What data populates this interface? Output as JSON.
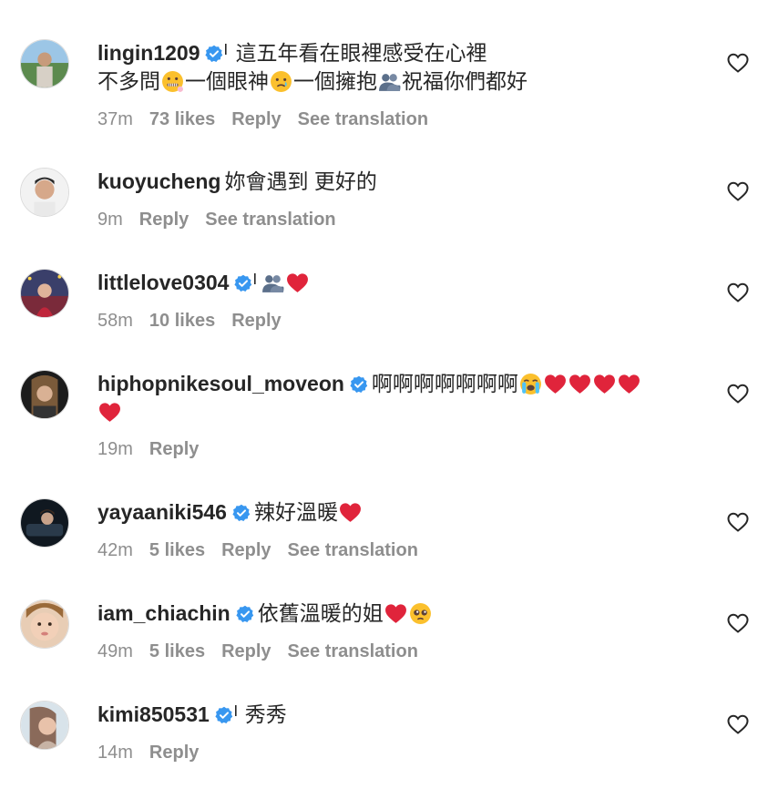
{
  "labels": {
    "reply": "Reply",
    "see_translation": "See translation"
  },
  "comments": [
    {
      "username": "lingin1209",
      "verified": true,
      "text_line1": "這五年看在眼裡感受在心裡",
      "text_line2_a": "不多問",
      "text_line2_b": "一個眼神",
      "text_line2_c": "一個擁抱",
      "text_line2_d": "祝福你們都好",
      "time": "37m",
      "likes": "73 likes"
    },
    {
      "username": "kuoyucheng",
      "verified": false,
      "text": "妳會遇到 更好的",
      "time": "9m"
    },
    {
      "username": "littlelove0304",
      "verified": true,
      "time": "58m",
      "likes": "10 likes"
    },
    {
      "username": "hiphopnikesoul_moveon",
      "verified": true,
      "text": "啊啊啊啊啊啊啊",
      "time": "19m"
    },
    {
      "username": "yayaaniki546",
      "verified": true,
      "text": "辣好溫暖",
      "time": "42m",
      "likes": "5 likes"
    },
    {
      "username": "iam_chiachin",
      "verified": true,
      "text": "依舊溫暖的姐",
      "time": "49m",
      "likes": "5 likes"
    },
    {
      "username": "kimi850531",
      "verified": true,
      "text": "秀秀",
      "time": "14m"
    }
  ],
  "colors": {
    "verified": "#3897f0",
    "meta": "#8e8e8e",
    "heart": "#e0243b"
  }
}
